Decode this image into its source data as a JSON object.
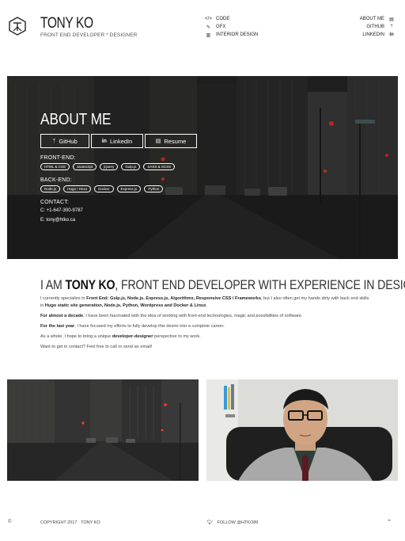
{
  "brand": {
    "title": "TONY KO",
    "subtitle": "FRONT END DEVELOPER * DESIGNER"
  },
  "nav_mid": [
    {
      "icon": "code-icon",
      "glyph": "</>",
      "label": "CODE"
    },
    {
      "icon": "brush-icon",
      "glyph": "✎",
      "label": "GFX"
    },
    {
      "icon": "building-icon",
      "glyph": "▥",
      "label": "INTERIOR DESIGN"
    }
  ],
  "nav_right": [
    {
      "icon": "id-card-icon",
      "glyph": "▤",
      "label": "ABOUT ME"
    },
    {
      "icon": "branch-icon",
      "glyph": "ᛘ",
      "label": "GITHUB"
    },
    {
      "icon": "linkedin-icon",
      "glyph": "in",
      "label": "LINKEDIN"
    }
  ],
  "hero": {
    "title": "ABOUT ME",
    "buttons": {
      "github": "GitHub",
      "linkedin": "LinkedIn",
      "resume": "Resume"
    },
    "front_end_label": "FRONT-END:",
    "front_end_tags": [
      "HTML & CSS",
      "Javascript",
      "jQuery",
      "Gulp.js",
      "SASS & SCSS"
    ],
    "back_end_label": "BACK-END:",
    "back_end_tags": [
      "Node.js",
      "Hugo / Hexo",
      "Docker",
      "Express.js",
      "Python"
    ],
    "contact_label": "CONTACT:",
    "phone": "C: +1-647-300-9787",
    "email": "E: tony@htko.ca"
  },
  "about": {
    "heading_pre": "I AM ",
    "heading_name": "TONY KO",
    "heading_post": ", FRONT END DEVELOPER WITH EXPERIENCE IN DESIGN.",
    "p1_a": "I currently specialize in ",
    "p1_b": "Front End: Gulp.js, Node.js, Express.js, Algorithms, Responsive CSS / Frameworks",
    "p1_c": ", but I also often get my hands dirty with back end skills in ",
    "p1_d": "Hugo static site generation, Node.js, Python, Wordpress and Docker & Linux",
    "p1_e": ".",
    "p2_a": "For almost a decade",
    "p2_b": ", I have been fascinated with the idea of working with front-end technologies, magic and possibilities of software.",
    "p3_a": "For the last year",
    "p3_b": ", I have focused my efforts to fully develop this desire into a complete career.",
    "p4_a": "As a whole, I hope to bring a unique ",
    "p4_b": "developer-designer",
    "p4_c": " perspective to my work.",
    "p5": "Want to get in contact? Feel free to call or send an email!"
  },
  "footer": {
    "copyright_icon": "©",
    "copyright": "COPYRIGHT 2017 · TONY KO",
    "follow": "FOLLOW @HTKO89",
    "top_glyph": "⌃"
  },
  "colors": {
    "text": "#333333",
    "hero_overlay": "#000000",
    "light_red": "#ff3b2a"
  }
}
